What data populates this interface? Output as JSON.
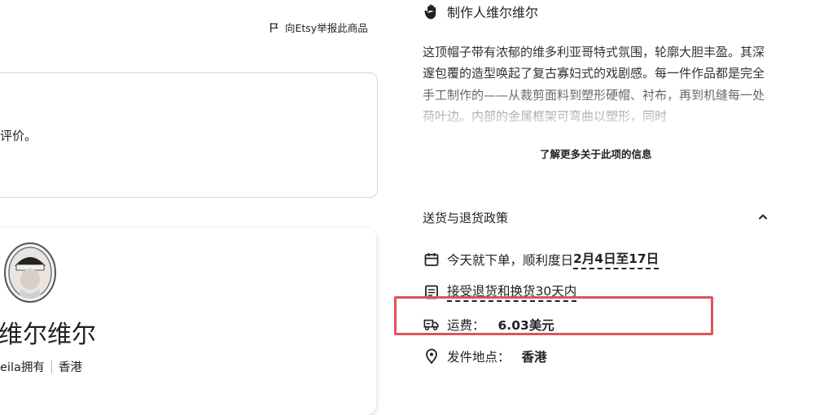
{
  "report": {
    "label": "向Etsy举报此商品"
  },
  "review": {
    "text": "评价。"
  },
  "shop": {
    "name": "维尔维尔",
    "owner": "eila拥有",
    "location": "香港"
  },
  "maker": {
    "label": "制作人维尔维尔"
  },
  "description": {
    "text": "这顶帽子带有浓郁的维多利亚哥特式氛围，轮廓大胆丰盈。其深邃包覆的造型唤起了复古寡妇式的戏剧感。每一件作品都是完全手工制作的——从裁剪面料到塑形硬帽、衬布，再到机缝每一处荷叶边。内部的金属框架可弯曲以塑形，同时"
  },
  "learn_more": {
    "label": "了解更多关于此项的信息"
  },
  "policy": {
    "title": "送货与退货政策",
    "delivery": {
      "prefix": "今天就下单，顺利度日",
      "dates": "2月4日至17日"
    },
    "returns": {
      "label": "接受退货和换货30天内"
    },
    "shipping": {
      "label": "运费：",
      "value": "6.03美元"
    },
    "origin": {
      "label": "发件地点：",
      "value": "香港"
    }
  },
  "colors": {
    "highlight": "#e0525b",
    "border": "#d6d6d6",
    "text": "#222222"
  }
}
